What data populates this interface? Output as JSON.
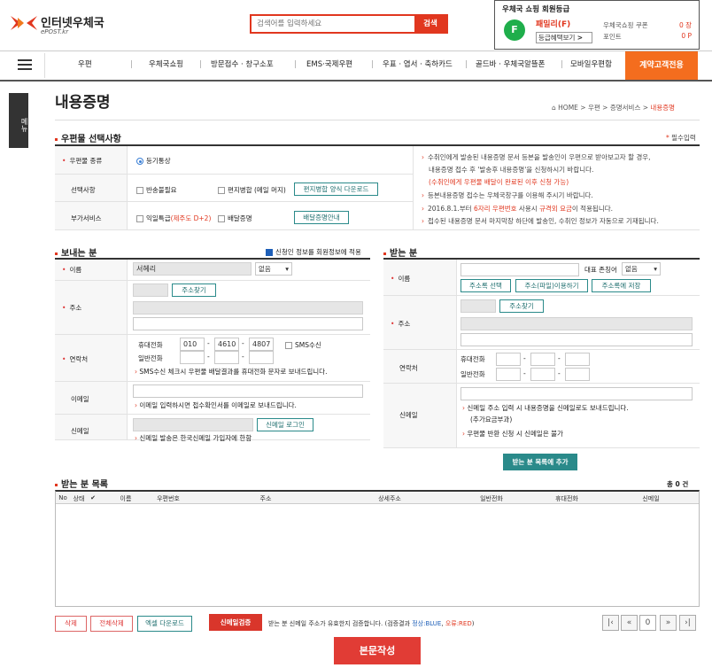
{
  "header": {
    "logo_text": "인터넷우체국",
    "logo_sub": "ePOST.kr",
    "search_placeholder": "검색어를 입력하세요",
    "search_button": "검색",
    "member": {
      "title": "우체국 쇼핑 회원등급",
      "grade": "패밀리(F)",
      "grade_letter": "F",
      "benefit_btn": "등급혜택보기",
      "coupon_label": "우체국쇼핑 쿠폰",
      "coupon_value": "0 장",
      "point_label": "포인트",
      "point_value": "0 P"
    }
  },
  "nav": {
    "items": [
      "우편",
      "우체국쇼핑",
      "방문접수 · 창구소포",
      "EMS·국제우편",
      "우표 · 엽서 · 축하카드",
      "골드바 · 우체국알뜰폰",
      "모바일우편함"
    ],
    "highlight": "계약고객전용",
    "side_tab": "메뉴"
  },
  "page": {
    "title": "내용증명",
    "breadcrumb": [
      "HOME",
      "우편",
      "증명서비스",
      "내용증명"
    ],
    "required_note": "필수입력"
  },
  "mail_section": {
    "title": "우편물 선택사항",
    "type_label": "우편물 종류",
    "type_value": "등기통상",
    "options_label": "선택사항",
    "opt1": "반송불필요",
    "opt2": "편지병합 (메일 머지)",
    "opt_btn": "편지병합 양식 다운로드",
    "extra_label": "부가서비스",
    "extra1": "익일특급",
    "extra1_note": "(제주도 D+2)",
    "extra2": "배달증명",
    "extra_btn": "배달증명안내"
  },
  "info": {
    "l1": "수취인에게 발송된 내용증명 문서 등본을 발송인이 우편으로 받아보고자 할 경우,",
    "l2": "내용증명 접수 후 '발송후 내용증명'을 신청하시기 바랍니다.",
    "l3": "(수취인에게 우편물 배달이 완료된 이후 신청 가능)",
    "l4": "등본내용증명 접수는 우체국창구를 이용해 주시기 바랍니다.",
    "l5a": "2016.8.1.부터 ",
    "l5b": "6자리 우편번호",
    "l5c": " 사용시 ",
    "l5d": "규격외 요금",
    "l5e": "이 적용됩니다.",
    "l6": "접수된 내용증명 문서 마지막장 하단에 발송인, 수취인 정보가 자동으로 기재됩니다."
  },
  "sender": {
    "title": "보내는 분",
    "same_check": "신청인 정보를 회원정보에 적용",
    "name_label": "이름",
    "name_value": "서혜리",
    "title_select": "없음",
    "addr_label": "주소",
    "addr_btn": "주소찾기",
    "contact_label": "연락처",
    "mobile_label": "휴대전화",
    "m1": "010",
    "m2": "4610",
    "m3": "4807",
    "sms_label": "SMS수신",
    "phone_label": "일반전화",
    "sms_note": "SMS수신 체크시 우편물 배달결과를 휴대전화 문자로 보내드립니다.",
    "email_label": "이메일",
    "email_note": "이메일 입력하시면 접수확인서를 이메일로 보내드립니다.",
    "shin_label": "신메일",
    "shin_btn": "신메일 로그인",
    "shin_note": "신메일 발송은 한국신메일 가입자에 한함"
  },
  "receiver": {
    "title": "받는 분",
    "name_label": "이름",
    "rep_label": "대표 존칭어",
    "title_select": "없음",
    "btn1": "주소록 선택",
    "btn2": "주소(파일)이용하기",
    "btn3": "주소록에 저장",
    "addr_label": "주소",
    "addr_btn": "주소찾기",
    "contact_label": "연락처",
    "mobile_label": "휴대전화",
    "phone_label": "일반전화",
    "shin_label": "신메일",
    "note1": "신메일 주소 입력 시 내용증명을 신메일로도 보내드립니다.",
    "note1b": "(추가요금부과)",
    "note2": "우편물 반환 신청 시 신메일은 불가",
    "add_btn": "받는 분 목록에 추가"
  },
  "list": {
    "title": "받는 분 목록",
    "count": "총 0 건",
    "headers": [
      "No",
      "상태",
      "✔",
      "이름",
      "우편번호",
      "주소",
      "상세주소",
      "일반전화",
      "휴대전화",
      "신메일"
    ]
  },
  "footer": {
    "del_btn": "삭제",
    "del_all_btn": "전체삭제",
    "excel_btn": "엑셀 다운로드",
    "verify_btn": "신메일검증",
    "verify_note_a": "받는 분 신메일 주소가 유효한지 검증합니다. (검증결과 ",
    "verify_ok": "정상:BLUE",
    "verify_sep": ", ",
    "verify_err": "오류:RED",
    "verify_end": ")",
    "page_num": "0",
    "submit_btn": "본문작성"
  },
  "colors": {
    "accent": "#e1371f",
    "teal": "#2a8a8a",
    "nav_highlight": "#f46d1e",
    "green": "#1fae4b"
  }
}
